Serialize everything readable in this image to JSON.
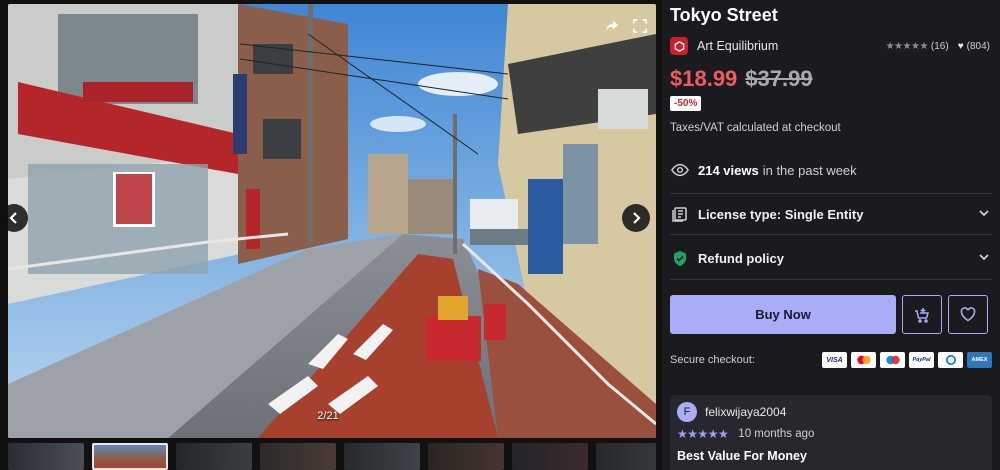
{
  "product": {
    "title": "Tokyo Street",
    "seller": "Art Equilibrium",
    "rating_count": "(16)",
    "likes": "(804)",
    "price": "$18.99",
    "old_price": "$37.99",
    "discount": "-50%",
    "taxes_note": "Taxes/VAT calculated at checkout"
  },
  "gallery": {
    "counter": "2/21",
    "thumbnail_count": 8,
    "active_thumbnail": 2
  },
  "views": {
    "count": "214 views",
    "suffix": "in the past week"
  },
  "accordion": {
    "license": "License type: Single Entity",
    "refund": "Refund policy"
  },
  "actions": {
    "buy_label": "Buy Now"
  },
  "checkout": {
    "label": "Secure checkout:",
    "cards": [
      "VISA",
      "mastercard",
      "maestro",
      "PayPal",
      "diners",
      "AMEX"
    ]
  },
  "review": {
    "avatar_letter": "F",
    "username": "felixwijaya2004",
    "stars": "★★★★★",
    "time": "10 months ago",
    "title": "Best Value For Money"
  },
  "colors": {
    "accent": "#a9acf6",
    "price_red": "#f05a62",
    "background": "#1b1b1f"
  }
}
